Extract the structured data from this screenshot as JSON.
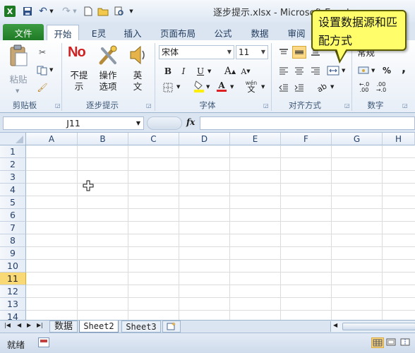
{
  "window": {
    "title": "逐步提示.xlsx - Microsoft Excel"
  },
  "tabs": [
    "文件",
    "开始",
    "E灵",
    "插入",
    "页面布局",
    "公式",
    "数据",
    "审阅"
  ],
  "clipboard": {
    "paste": "粘贴",
    "group": "剪贴板"
  },
  "hints": {
    "no_label": "不提示",
    "ops_label": "操作选项",
    "en_label": "英文",
    "group": "逐步提示"
  },
  "font": {
    "name": "宋体",
    "size": "11",
    "group": "字体",
    "wen": "wén"
  },
  "align": {
    "group": "对齐方式"
  },
  "number": {
    "format": "常规",
    "group": "数字",
    "percent": "%",
    "comma": ","
  },
  "callout": {
    "text": "设置数据源和匹配方式"
  },
  "formula": {
    "namebox": "J11",
    "fx": "fx",
    "value": ""
  },
  "columns": [
    "A",
    "B",
    "C",
    "D",
    "E",
    "F",
    "G",
    "H"
  ],
  "rows": [
    "1",
    "2",
    "3",
    "4",
    "5",
    "6",
    "7",
    "8",
    "9",
    "10",
    "11",
    "12",
    "13",
    "14"
  ],
  "active_row": "11",
  "sheets": [
    "数据",
    "Sheet2",
    "Sheet3"
  ],
  "active_sheet": "Sheet2",
  "status": {
    "ready": "就绪"
  },
  "colors": {
    "file_tab": "#2a8a30",
    "callout": "#fffe6a",
    "active_row": "#f9d976"
  }
}
